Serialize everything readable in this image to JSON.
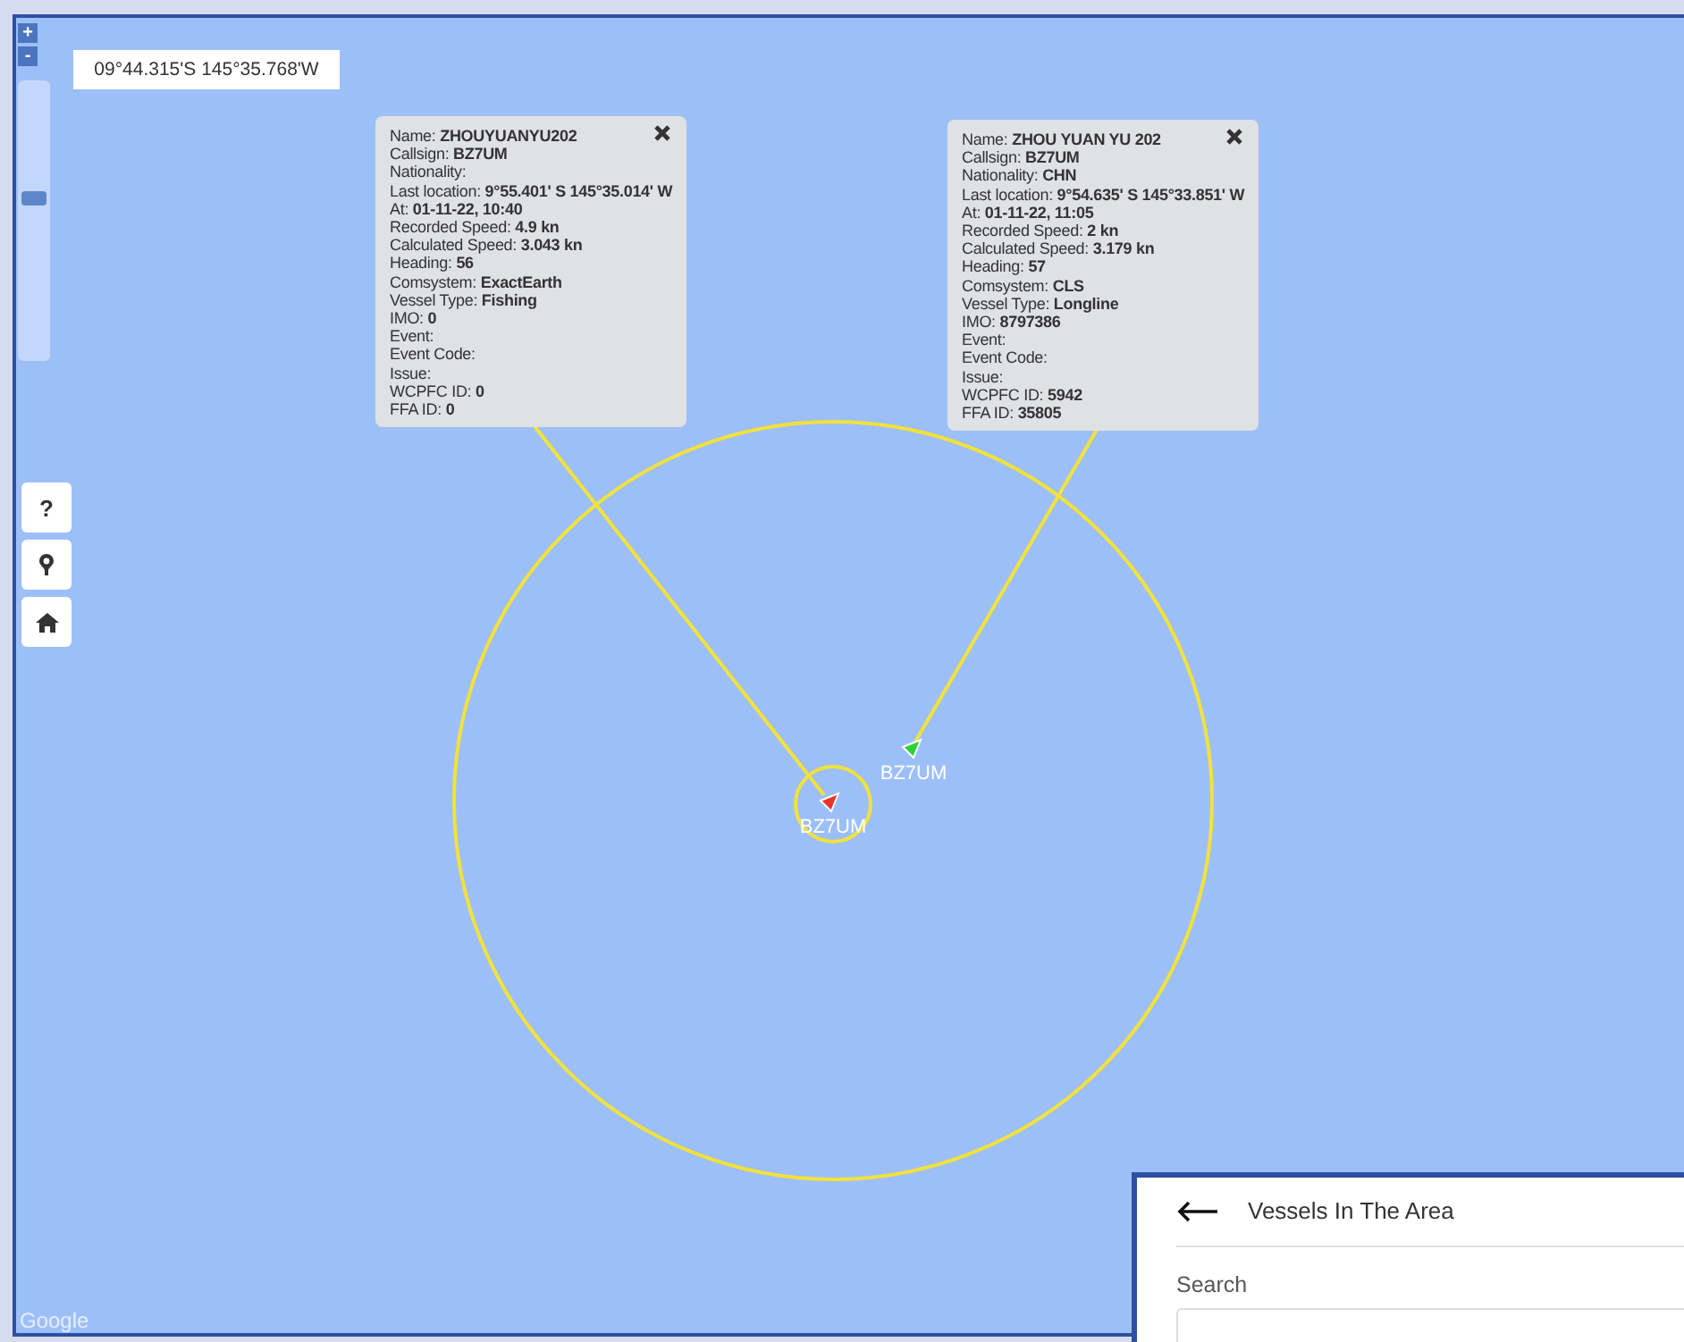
{
  "map": {
    "coordinates": "09°44.315'S 145°35.768'W",
    "zoom_in": "+",
    "zoom_out": "-",
    "zoom_slider": {
      "level": 0.58
    },
    "help_button": "?",
    "attribution": "Google"
  },
  "vessels": [
    {
      "label": "BZ7UM",
      "color": "#e8352b",
      "popup": [
        "Name: **ZHOUYUANYU202**",
        "Callsign: **BZ7UM**",
        "Nationality:",
        "Last location: **9°55.401' S 145°35.014' W**",
        "At: **01-11-22, 10:40**",
        "Recorded Speed: **4.9 kn**",
        "Calculated Speed: **3.043 kn**",
        "Heading: **56**",
        "Comsystem: **ExactEarth**",
        "Vessel Type: **Fishing**",
        "IMO: **0**",
        "Event:",
        "Event Code:",
        "Issue:",
        "WCPFC ID: **0**",
        "FFA ID: **0**"
      ]
    },
    {
      "label": "BZ7UM",
      "color": "#2fcf3a",
      "popup": [
        "Name: **ZHOU YUAN YU 202**",
        "Callsign: **BZ7UM**",
        "Nationality: **CHN**",
        "Last location: **9°54.635' S 145°33.851' W**",
        "At: **01-11-22, 11:05**",
        "Recorded Speed: **2 kn**",
        "Calculated Speed: **3.179 kn**",
        "Heading: **57**",
        "Comsystem: **CLS**",
        "Vessel Type: **Longline**",
        "IMO: **8797386**",
        "Event:",
        "Event Code:",
        "Issue:",
        "WCPFC ID: **5942**",
        "FFA ID: **35805**"
      ]
    }
  ],
  "panel": {
    "title": "Vessels In The Area",
    "search_label": "Search"
  }
}
